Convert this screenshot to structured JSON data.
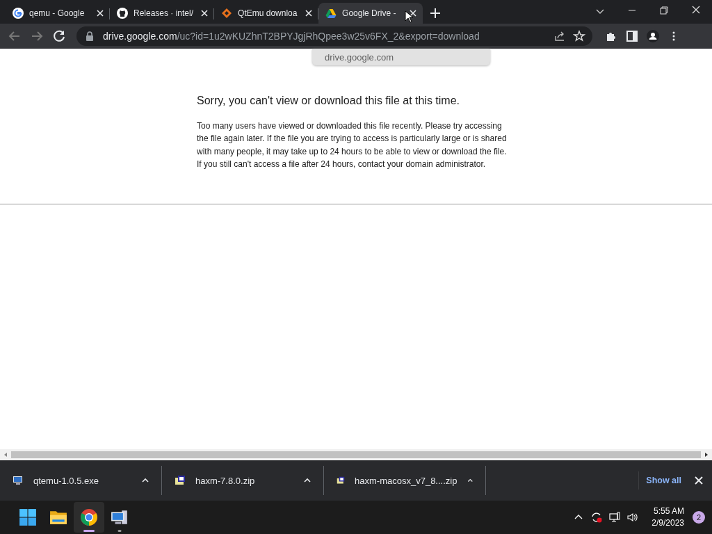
{
  "tabs": [
    {
      "title": "qemu - Google",
      "kind": "google",
      "selected": false
    },
    {
      "title": "Releases · intel/",
      "kind": "github",
      "selected": false
    },
    {
      "title": "QtEmu downloa",
      "kind": "diamond",
      "selected": false
    },
    {
      "title": "Google Drive -",
      "kind": "drive",
      "selected": true
    }
  ],
  "address_bar": {
    "host": "drive.google.com",
    "path": "/uc?id=1u2wKUZhnT2BPYJgjRhQpee3w25v6FX_2&export=download"
  },
  "tooltip": {
    "text": "drive.google.com"
  },
  "page": {
    "heading": "Sorry, you can't view or download this file at this time.",
    "message": "Too many users have viewed or downloaded this file recently. Please try accessing the file again later. If the file you are trying to access is particularly large or is shared with many people, it may take up to 24 hours to be able to view or download the file. If you still can't access a file after 24 hours, contact your domain administrator."
  },
  "downloads": {
    "items": [
      {
        "filename": "qtemu-1.0.5.exe",
        "kind": "exe"
      },
      {
        "filename": "haxm-7.8.0.zip",
        "kind": "zip"
      },
      {
        "filename": "haxm-macosx_v7_8....zip",
        "kind": "zip"
      }
    ],
    "show_all": "Show all"
  },
  "taskbar": {
    "apps": [
      {
        "kind": "start",
        "selected": false
      },
      {
        "kind": "explorer",
        "selected": false
      },
      {
        "kind": "chrome",
        "selected": true
      },
      {
        "kind": "computer",
        "selected": false
      }
    ],
    "time": "5:55 AM",
    "date": "2/9/2023",
    "notifications": "2"
  }
}
